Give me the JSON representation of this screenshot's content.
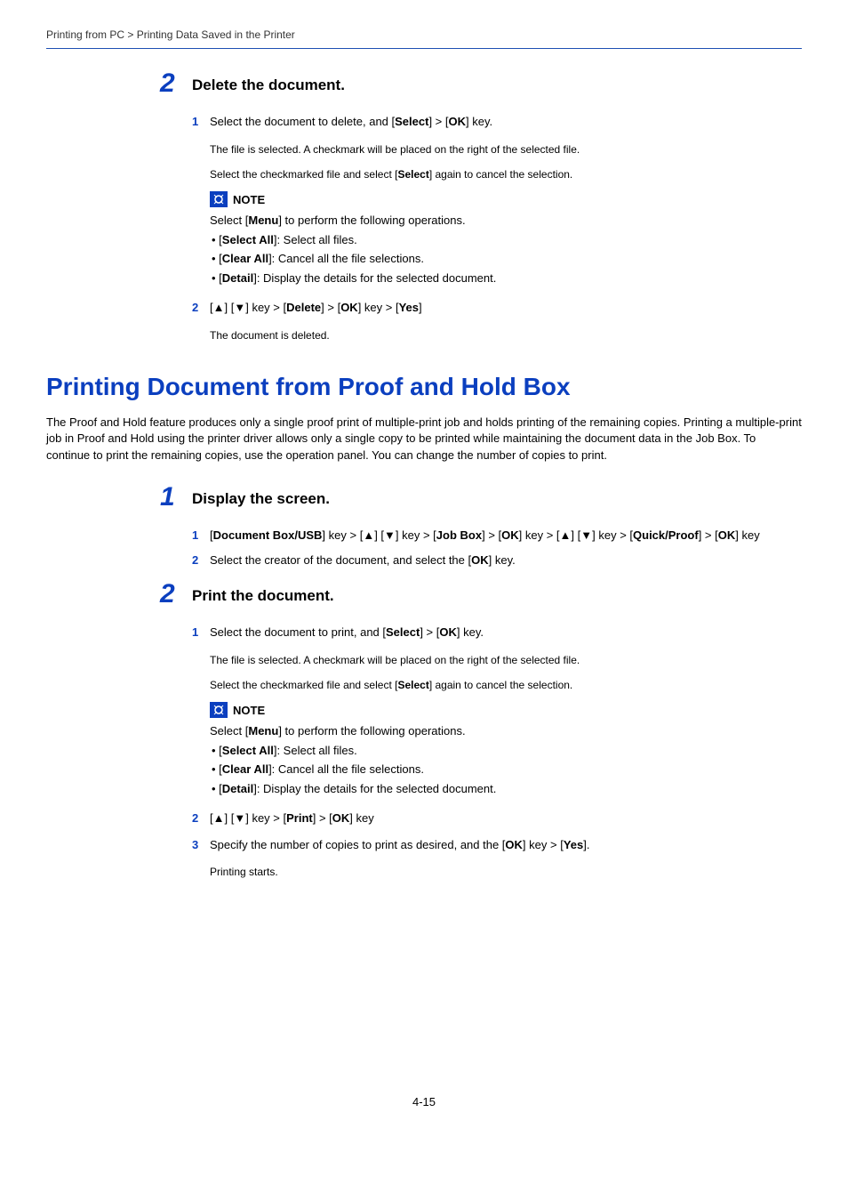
{
  "breadcrumb": "Printing from PC > Printing Data Saved in the Printer",
  "page_number": "4-15",
  "symbols": {
    "up": "▲",
    "down": "▼",
    "bullet": "•"
  },
  "section1": {
    "step2": {
      "num": "2",
      "title": "Delete the document.",
      "items": [
        {
          "num": "1",
          "parts": [
            "Select the document to delete, and [",
            "Select",
            "] > [",
            "OK",
            "] key."
          ],
          "after": [
            "The file is selected. A checkmark will be placed on the right of the selected file.",
            {
              "parts": [
                "Select the checkmarked file and select [",
                "Select",
                "] again to cancel the selection."
              ]
            }
          ],
          "note": {
            "label": "NOTE",
            "intro": {
              "parts": [
                "Select [",
                "Menu",
                "] to perform the following operations."
              ]
            },
            "bullets": [
              {
                "parts": [
                  "[",
                  "Select All",
                  "]: Select all files."
                ]
              },
              {
                "parts": [
                  "[",
                  "Clear All",
                  "]: Cancel all the file selections."
                ]
              },
              {
                "parts": [
                  "[",
                  "Detail",
                  "]: Display the details for the selected document."
                ]
              }
            ]
          }
        },
        {
          "num": "2",
          "parts": [
            "[",
            "▲",
            "] [",
            "▼",
            "] key > [",
            "Delete",
            "] > [",
            "OK",
            "] key > [",
            "Yes",
            "]"
          ],
          "after": [
            "The document is deleted."
          ]
        }
      ]
    }
  },
  "section2": {
    "heading": "Printing Document from Proof and Hold Box",
    "intro": "The Proof and Hold feature produces only a single proof print of multiple-print job and holds printing of the remaining copies. Printing a multiple-print job in Proof and Hold using the printer driver allows only a single copy to be printed while maintaining the document data in the Job Box. To continue to print the remaining copies, use the operation panel. You can change the number of copies to print.",
    "step1": {
      "num": "1",
      "title": "Display the screen.",
      "items": [
        {
          "num": "1",
          "parts": [
            "[",
            "Document Box/USB",
            "] key > [",
            "▲",
            "] [",
            "▼",
            "] key > [",
            "Job Box",
            "] > [",
            "OK",
            "] key > [",
            "▲",
            "] [",
            "▼",
            "] key > [",
            "Quick/Proof",
            "] > [",
            "OK",
            "] key"
          ]
        },
        {
          "num": "2",
          "parts": [
            "Select the creator of the document, and select the [",
            "OK",
            "] key."
          ]
        }
      ]
    },
    "step2": {
      "num": "2",
      "title": "Print the document.",
      "items": [
        {
          "num": "1",
          "parts": [
            "Select the document to print, and [",
            "Select",
            "] > [",
            "OK",
            "] key."
          ],
          "after": [
            "The file is selected. A checkmark will be placed on the right of the selected file.",
            {
              "parts": [
                "Select the checkmarked file and select [",
                "Select",
                "] again to cancel the selection."
              ]
            }
          ],
          "note": {
            "label": "NOTE",
            "intro": {
              "parts": [
                "Select [",
                "Menu",
                "] to perform the following operations."
              ]
            },
            "bullets": [
              {
                "parts": [
                  "[",
                  "Select All",
                  "]: Select all files."
                ]
              },
              {
                "parts": [
                  "[",
                  "Clear All",
                  "]: Cancel all the file selections."
                ]
              },
              {
                "parts": [
                  "[",
                  "Detail",
                  "]: Display the details for the selected document."
                ]
              }
            ]
          }
        },
        {
          "num": "2",
          "parts": [
            "[",
            "▲",
            "] [",
            "▼",
            "] key > [",
            "Print",
            "] > [",
            "OK",
            "] key"
          ]
        },
        {
          "num": "3",
          "parts": [
            "Specify the number of copies to print as desired, and the [",
            "OK",
            "] key > [",
            "Yes",
            "]."
          ],
          "after": [
            "Printing starts."
          ]
        }
      ]
    }
  }
}
